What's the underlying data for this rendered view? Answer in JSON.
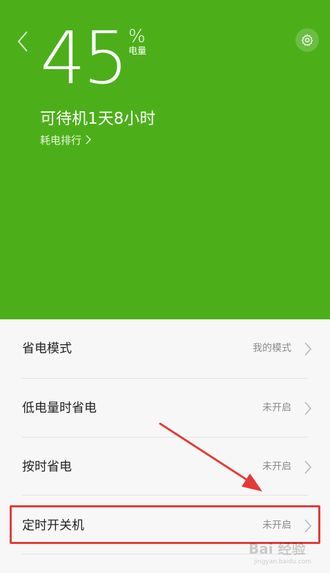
{
  "battery": {
    "percent": "45",
    "percent_sign": "%",
    "percent_label": "电量",
    "standby_text": "可待机1天8小时",
    "rank_label": "耗电排行"
  },
  "colors": {
    "hero_bg": "#4caf1a",
    "list_bg": "#f7f7f7",
    "annotation_red": "#e53935"
  },
  "icons": {
    "back": "chevron-left-icon",
    "settings": "gear-icon",
    "row_arrow": "chevron-right-icon"
  },
  "settings_list": [
    {
      "title": "省电模式",
      "status": "我的模式"
    },
    {
      "title": "低电量时省电",
      "status": "未开启"
    },
    {
      "title": "按时省电",
      "status": "未开启"
    },
    {
      "title": "定时开关机",
      "status": "未开启"
    }
  ],
  "watermark": {
    "brand": "Bai 经验",
    "url": "jingyan.baidu.com"
  }
}
